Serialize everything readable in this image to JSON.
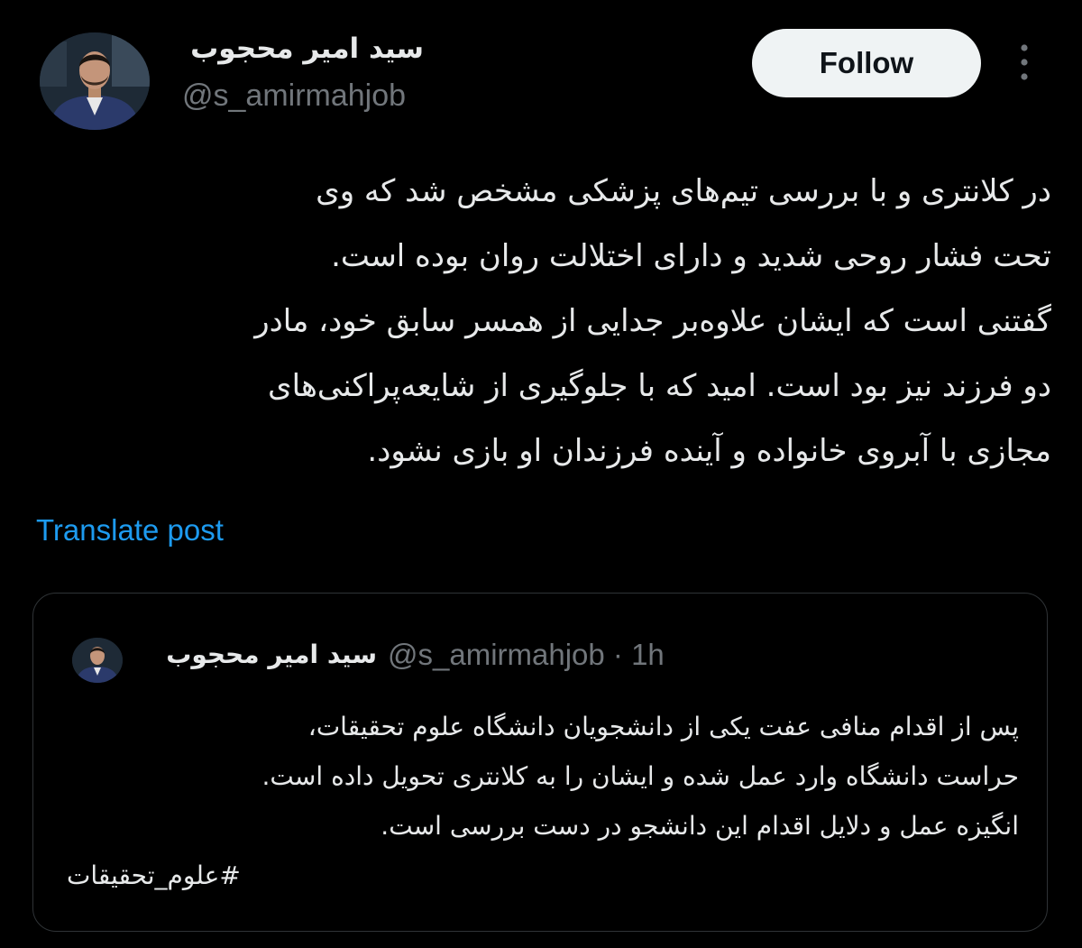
{
  "author": {
    "display_name": "سید امیر محجوب",
    "handle": "@s_amirmahjob",
    "avatar_icon": "profile-photo"
  },
  "actions": {
    "follow_label": "Follow",
    "more_icon": "vertical-ellipsis-icon"
  },
  "tweet": {
    "lines": [
      "در کلانتری و با بررسی تیم‌های پزشکی مشخص شد که وی",
      "تحت فشار روحی شدید و دارای اختلالت روان بوده است.",
      "گفتنی است که ایشان علاوه‌بر جدایی از همسر سابق خود، مادر",
      "دو فرزند نیز بود است. امید که با جلوگیری از شایعه‌پراکنی‌های",
      "مجازی با آبروی خانواده و آینده فرزندان او بازی نشود."
    ],
    "translate_label": "Translate post"
  },
  "quoted_tweet": {
    "display_name": "سید امیر محجوب",
    "meta": "@s_amirmahjob · 1h",
    "lines": [
      "پس از اقدام منافی عفت یکی از دانشجویان دانشگاه علوم تحقیقات،",
      "حراست دانشگاه وارد عمل شده و ایشان را به کلانتری تحویل داده است.",
      "انگیزه عمل و دلایل اقدام این دانشجو در دست بررسی است."
    ],
    "hashtag": "#علوم_تحقیقات"
  },
  "colors": {
    "background": "#000000",
    "text": "#e7e9ea",
    "secondary_text": "#71767b",
    "link": "#1d9bf0",
    "button_bg": "#eff3f4",
    "border": "#2f3336"
  }
}
